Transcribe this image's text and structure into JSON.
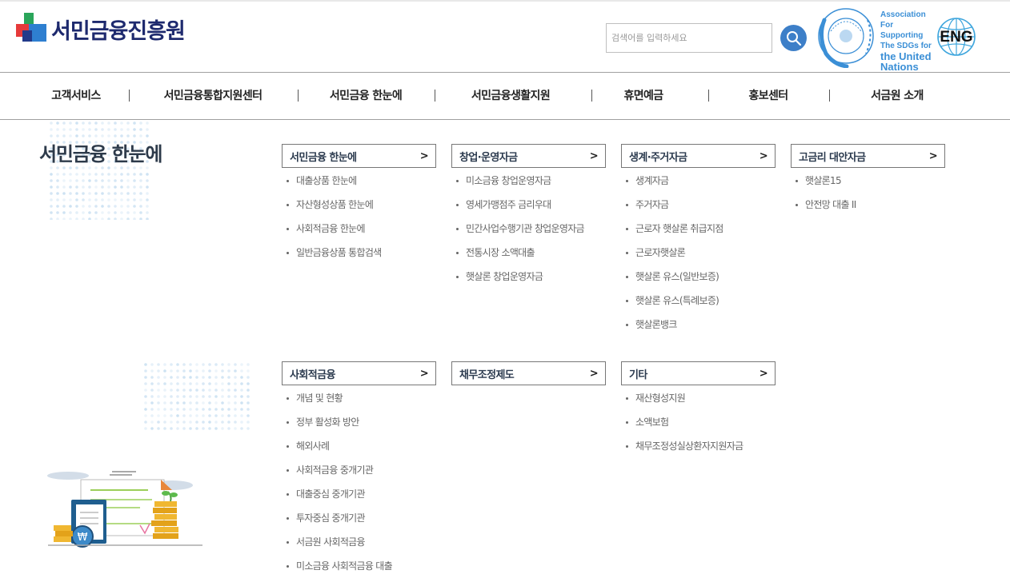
{
  "header": {
    "logo_text": "서민금융진흥원",
    "search_placeholder": "검색어를 입력하세요",
    "sdg_line1": "Association",
    "sdg_line2": "For Supporting",
    "sdg_line3": "The SDGs for",
    "sdg_line4": "the United",
    "sdg_line5": "Nations",
    "eng_label": "ENG"
  },
  "nav": {
    "items": [
      "고객서비스",
      "서민금융통합지원센터",
      "서민금융 한눈에",
      "서민금융생활지원",
      "휴면예금",
      "홍보센터",
      "서금원 소개"
    ]
  },
  "page": {
    "title": "서민금융 한눈에"
  },
  "menus": [
    {
      "title": "서민금융 한눈에",
      "items": [
        "대출상품 한눈에",
        "자산형성상품 한눈에",
        "사회적금융 한눈에",
        "일반금융상품 통합검색"
      ]
    },
    {
      "title": "창업·운영자금",
      "items": [
        "미소금융 창업운영자금",
        "영세가맹점주 금리우대",
        "민간사업수행기관 창업운영자금",
        "전통시장 소액대출",
        "햇살론 창업운영자금"
      ]
    },
    {
      "title": "생계·주거자금",
      "items": [
        "생계자금",
        "주거자금",
        "근로자 햇살론 취급지점",
        "근로자햇살론",
        "햇살론 유스(일반보증)",
        "햇살론 유스(특례보증)",
        "햇살론뱅크"
      ]
    },
    {
      "title": "고금리 대안자금",
      "items": [
        "햇살론15",
        "안전망 대출 II"
      ]
    },
    {
      "title": "사회적금융",
      "items": [
        "개념 및 현황",
        "정부 활성화 방안",
        "해외사례",
        "사회적금융 중개기관",
        "대출중심 중개기관",
        "투자중심 중개기관",
        "서금원 사회적금융",
        "미소금융 사회적금융 대출"
      ]
    },
    {
      "title": "채무조정제도",
      "items": []
    },
    {
      "title": "기타",
      "items": [
        "재산형성지원",
        "소액보험",
        "채무조정성실상환자지원자금"
      ]
    }
  ],
  "icons": {
    "search": "search-icon",
    "arrow": ">"
  },
  "colors": {
    "brand_navy": "#1e2a6e",
    "search_blue": "#3d7fc8",
    "sdg_blue": "#3b8fd6"
  }
}
